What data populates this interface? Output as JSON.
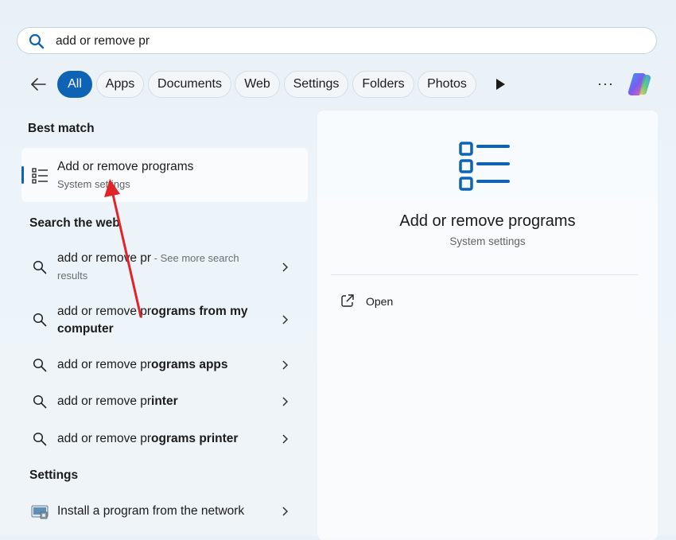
{
  "search": {
    "query": "add or remove pr"
  },
  "filters": [
    "All",
    "Apps",
    "Documents",
    "Web",
    "Settings",
    "Folders",
    "Photos"
  ],
  "more_label": "···",
  "best_match": {
    "heading": "Best match",
    "title": "Add or remove programs",
    "subtitle": "System settings"
  },
  "web": {
    "heading": "Search the web",
    "items": [
      {
        "prefix": "add or remove pr",
        "bold": "",
        "hint": " - See more search results"
      },
      {
        "prefix": "add or remove pr",
        "bold": "ograms from my computer",
        "hint": ""
      },
      {
        "prefix": "add or remove pr",
        "bold": "ograms apps",
        "hint": ""
      },
      {
        "prefix": "add or remove pr",
        "bold": "inter",
        "hint": ""
      },
      {
        "prefix": "add or remove pr",
        "bold": "ograms printer",
        "hint": ""
      }
    ]
  },
  "settings": {
    "heading": "Settings",
    "item": "Install a program from the network"
  },
  "preview": {
    "title": "Add or remove programs",
    "subtitle": "System settings",
    "open_label": "Open"
  },
  "colors": {
    "accent": "#0f63b5",
    "annotation_arrow": "#e0242a"
  }
}
